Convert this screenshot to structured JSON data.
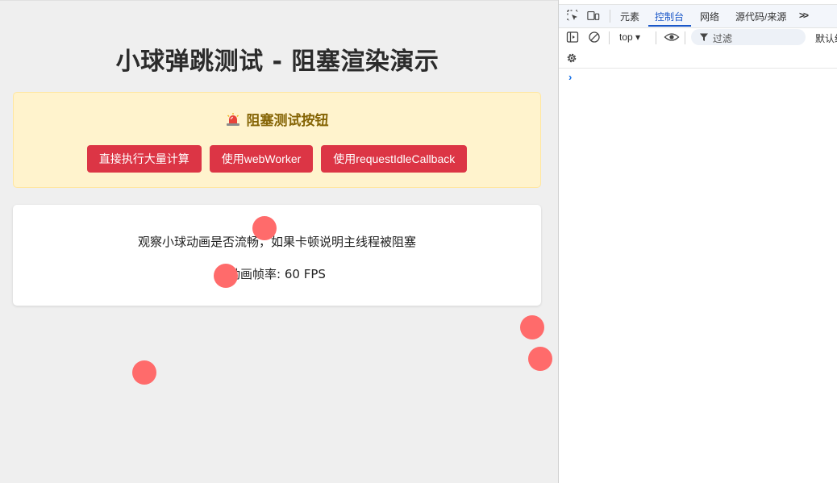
{
  "page": {
    "title": "小球弹跳测试 - 阻塞渲染演示",
    "blocking_panel": {
      "heading": "阻塞测试按钮",
      "heading_icon": "siren-icon",
      "buttons": {
        "direct_compute": "直接执行大量计算",
        "web_worker": "使用webWorker",
        "request_idle_callback": "使用requestIdleCallback"
      }
    },
    "animation_card": {
      "description": "观察小球动画是否流畅，如果卡顿说明主线程被阻塞",
      "fps_label": "动画帧率: ",
      "fps_value": "60",
      "fps_unit": " FPS"
    }
  },
  "devtools": {
    "tabs": {
      "elements": "元素",
      "console": "控制台",
      "network": "网络",
      "sources": "源代码/来源",
      "more": ">>"
    },
    "toolbar": {
      "context": "top",
      "filter_placeholder": "过滤",
      "levels": "默认级别"
    },
    "prompt": "›"
  },
  "colors": {
    "accent_red": "#dc3545",
    "ball": "#ff6b6b",
    "warning_bg": "#fff3cd",
    "warning_text": "#856404",
    "devtools_accent": "#1a57c8"
  }
}
